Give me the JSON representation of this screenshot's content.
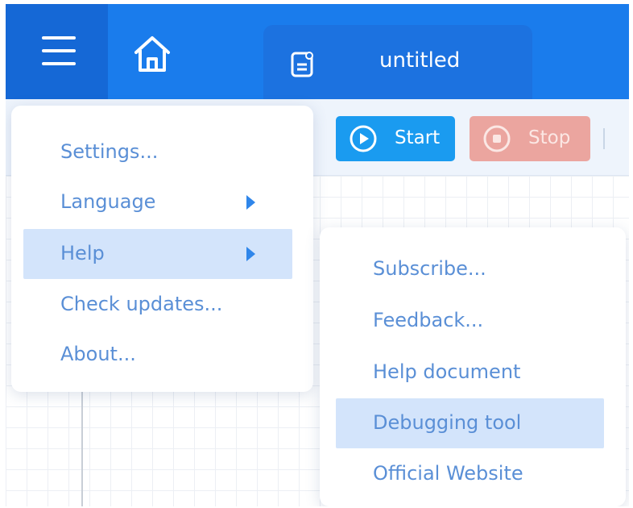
{
  "titlebar": {
    "menu_icon": "hamburger-icon",
    "home_icon": "home-icon",
    "document_icon": "document-icon",
    "document_title": "untitled"
  },
  "toolbar": {
    "start_label": "Start",
    "stop_label": "Stop",
    "start_icon": "play-circle-icon",
    "stop_icon": "stop-circle-icon"
  },
  "main_menu": {
    "items": [
      {
        "label": "Settings...",
        "submenu": false,
        "active": false
      },
      {
        "label": "Language",
        "submenu": true,
        "active": false
      },
      {
        "label": "Help",
        "submenu": true,
        "active": true
      },
      {
        "label": "Check updates...",
        "submenu": false,
        "active": false
      },
      {
        "label": "About...",
        "submenu": false,
        "active": false
      }
    ]
  },
  "help_submenu": {
    "items": [
      {
        "label": "Subscribe...",
        "active": false
      },
      {
        "label": "Feedback...",
        "active": false
      },
      {
        "label": "Help document",
        "active": false
      },
      {
        "label": "Debugging tool",
        "active": true
      },
      {
        "label": "Official Website",
        "active": false
      }
    ]
  },
  "colors": {
    "titlebar": "#1a7cec",
    "menu_text": "#5a8fd6",
    "highlight": "#d3e4fb",
    "start_button": "#1a9bf0",
    "stop_button": "#eba59f"
  }
}
